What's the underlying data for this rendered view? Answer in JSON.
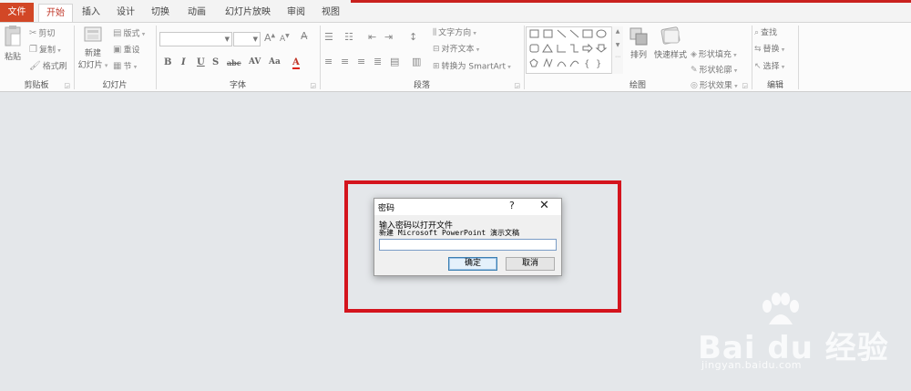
{
  "tabs": [
    {
      "label": "文件",
      "active": false
    },
    {
      "label": "开始",
      "active": true
    },
    {
      "label": "插入",
      "active": false
    },
    {
      "label": "设计",
      "active": false
    },
    {
      "label": "切换",
      "active": false
    },
    {
      "label": "动画",
      "active": false
    },
    {
      "label": "幻灯片放映",
      "active": false
    },
    {
      "label": "审阅",
      "active": false
    },
    {
      "label": "视图",
      "active": false
    }
  ],
  "ribbon": {
    "clipboard": {
      "label": "剪贴板",
      "paste": "粘贴",
      "cut": "剪切",
      "copy": "复制",
      "format_painter": "格式刷"
    },
    "slides": {
      "label": "幻灯片",
      "new_slide_line1": "新建",
      "new_slide_line2": "幻灯片",
      "layout": "版式",
      "reset": "重设",
      "section": "节"
    },
    "font": {
      "label": "字体",
      "font_name": "",
      "font_size": ""
    },
    "paragraph": {
      "label": "段落",
      "text_direction": "文字方向",
      "align_text": "对齐文本",
      "convert_smartart": "转换为 SmartArt"
    },
    "drawing": {
      "label": "绘图",
      "arrange": "排列",
      "quick_styles": "快速样式",
      "shape_fill": "形状填充",
      "shape_outline": "形状轮廓",
      "shape_effects": "形状效果"
    },
    "editing": {
      "label": "编辑",
      "find": "查找",
      "replace": "替换",
      "select": "选择"
    }
  },
  "dialog": {
    "title": "密码",
    "help": "?",
    "close": "✕",
    "prompt": "输入密码以打开文件",
    "filename": "新建 Microsoft PowerPoint 演示文稿",
    "password_value": "",
    "ok_label": "确定",
    "cancel_label": "取消"
  },
  "watermark": {
    "logo_text": "Bai du 经验",
    "url": "jingyan.baidu.com"
  },
  "colors": {
    "accent": "#d24726",
    "highlight_box": "#d4141d",
    "workspace": "#e4e7ea"
  }
}
